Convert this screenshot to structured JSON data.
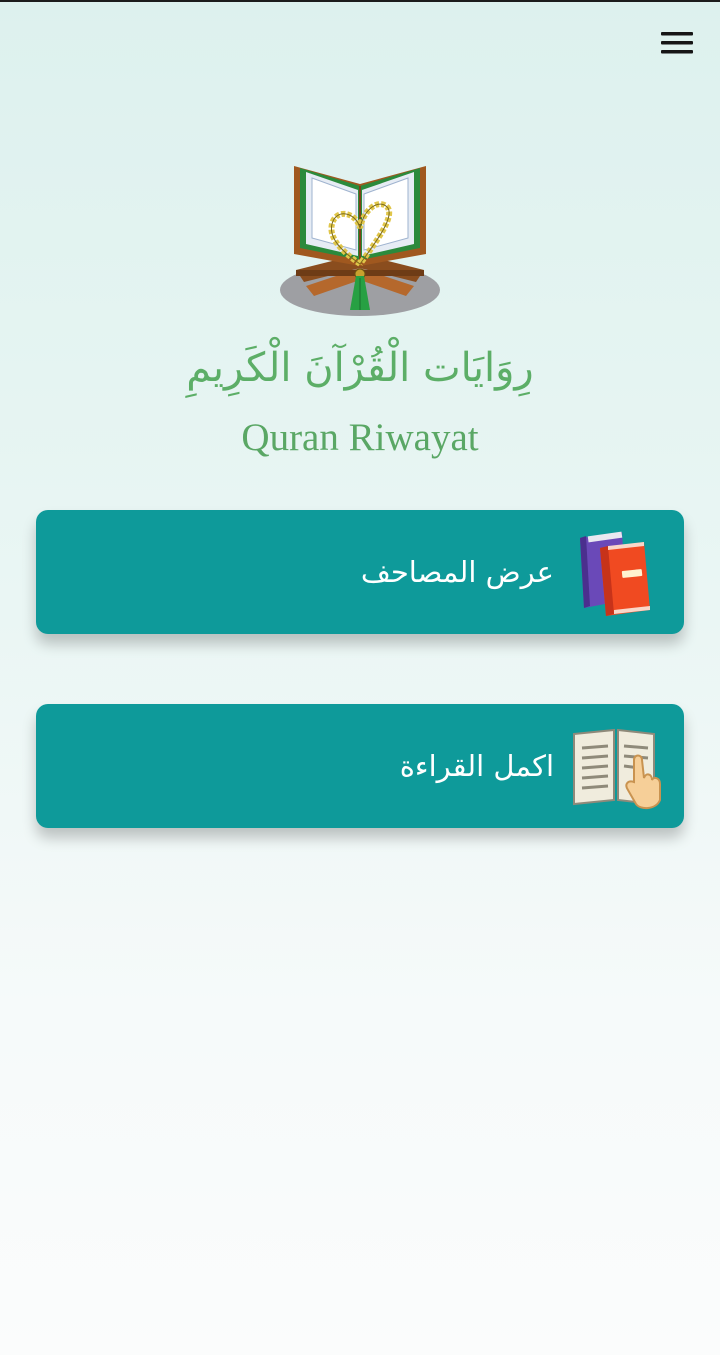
{
  "header": {
    "menu_icon": "hamburger-menu-icon"
  },
  "brand": {
    "logo_icon": "quran-on-stand-with-prayer-beads-icon",
    "title_arabic": "رِوَايَات الْقُرْآنَ الْكَرِيمِ",
    "title_english": "Quran Riwayat",
    "text_color": "#5cae67"
  },
  "actions": [
    {
      "label": "عرض المصاحف",
      "icon": "books-icon"
    },
    {
      "label": "اكمل القراءة",
      "icon": "open-book-pointer-icon"
    }
  ],
  "colors": {
    "card_background": "#0e9a9a",
    "card_text": "#ffffff",
    "background_top": "#ddf1ee",
    "background_bottom": "#fbfcfc"
  }
}
